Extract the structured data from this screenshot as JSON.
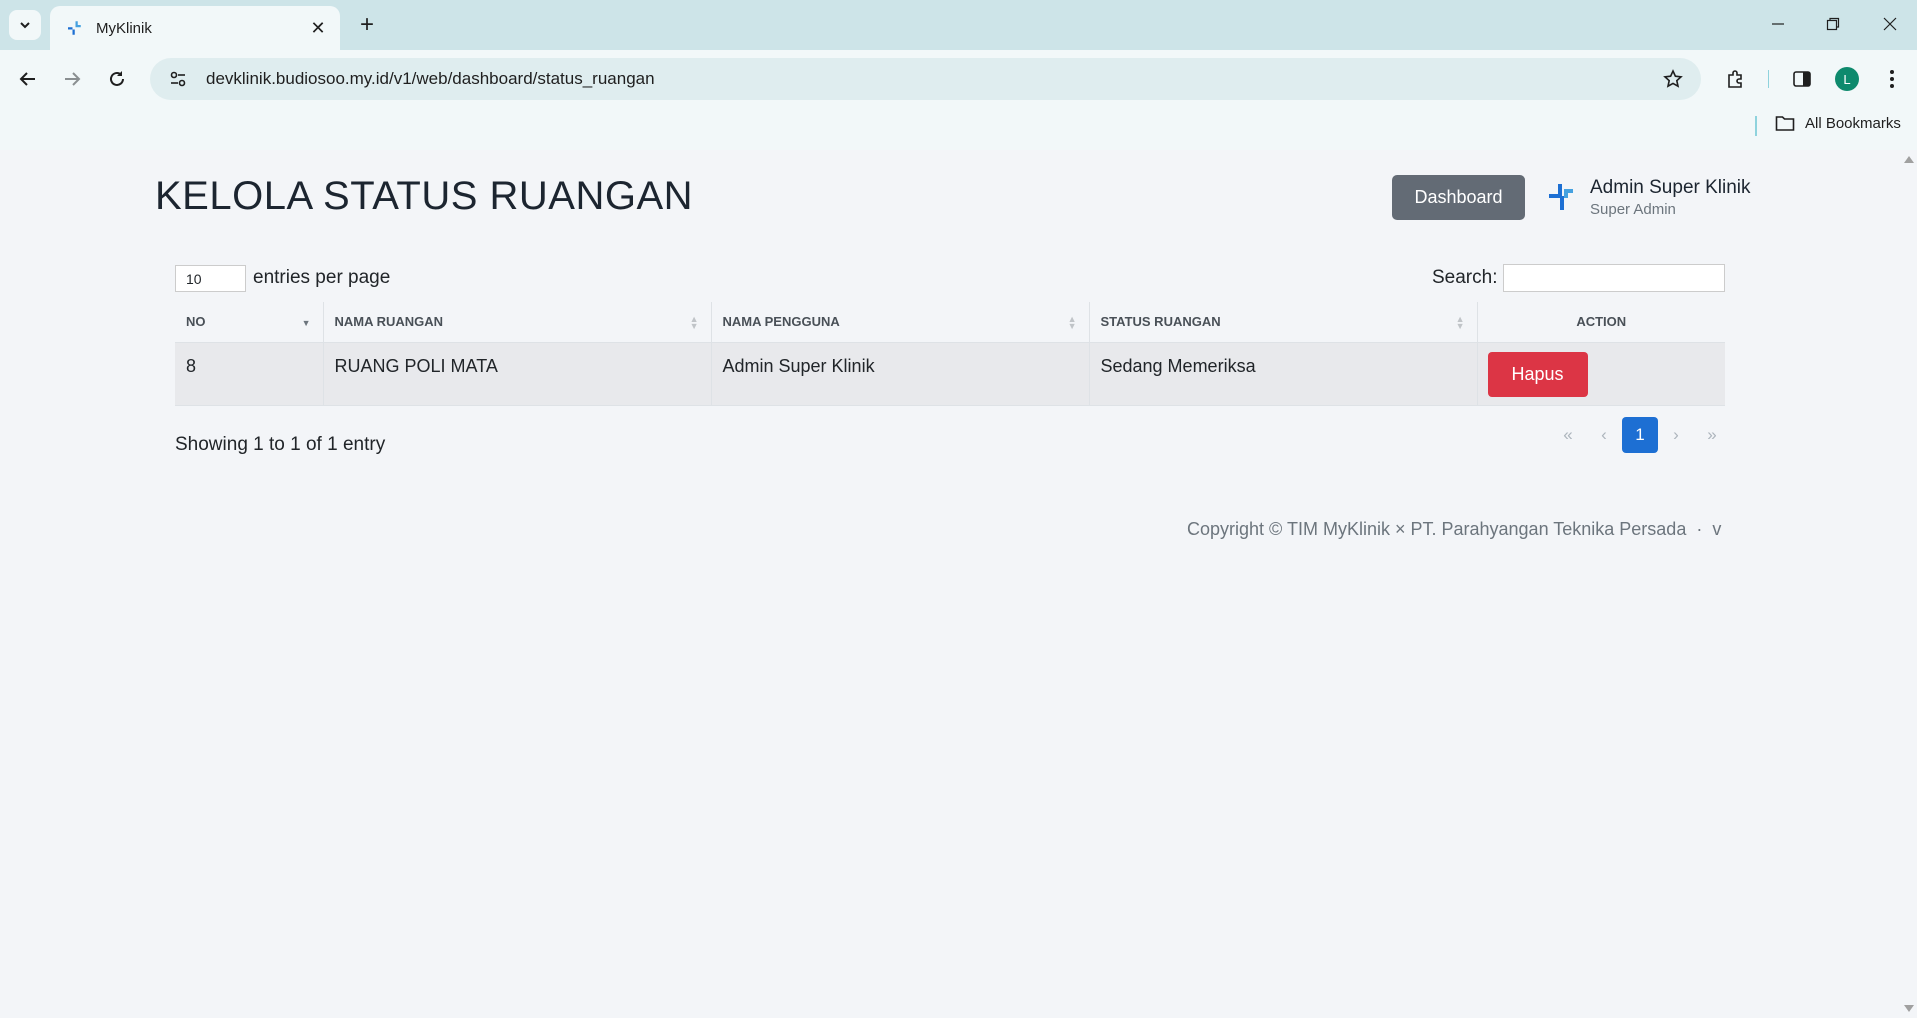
{
  "browser": {
    "tab_title": "MyKlinik",
    "url": "devklinik.budiosoo.my.id/v1/web/dashboard/status_ruangan",
    "profile_initial": "L",
    "bookmarks_label": "All Bookmarks"
  },
  "header": {
    "title": "KELOLA STATUS RUANGAN",
    "dashboard_label": "Dashboard",
    "user_name": "Admin Super Klinik",
    "user_role": "Super Admin"
  },
  "table_controls": {
    "entries_value": "10",
    "entries_label": "entries per page",
    "search_label": "Search:",
    "search_value": ""
  },
  "table": {
    "columns": [
      "NO",
      "NAMA RUANGAN",
      "NAMA PENGGUNA",
      "STATUS RUANGAN",
      "ACTION"
    ],
    "rows": [
      {
        "no": "8",
        "nama_ruangan": "RUANG POLI MATA",
        "nama_pengguna": "Admin Super Klinik",
        "status_ruangan": "Sedang Memeriksa",
        "action_label": "Hapus"
      }
    ]
  },
  "pagination": {
    "info": "Showing 1 to 1 of 1 entry",
    "first": "«",
    "prev": "‹",
    "current": "1",
    "next": "›",
    "last": "»"
  },
  "footer": {
    "copyright": "Copyright © TIM MyKlinik × PT. Parahyangan Teknika Persada  ·  v"
  },
  "colors": {
    "accent": "#1d6fd3",
    "danger": "#dc3545",
    "secondary": "#636b75"
  }
}
